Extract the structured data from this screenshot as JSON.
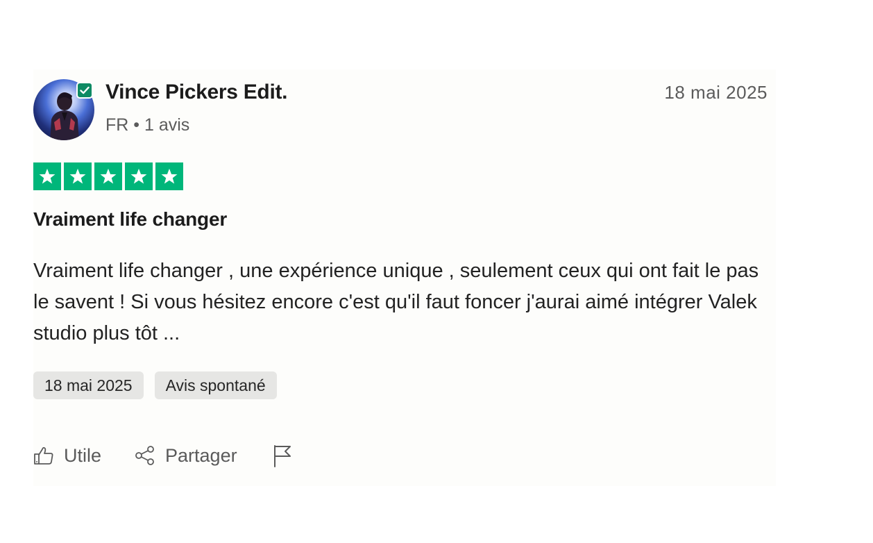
{
  "reviewer": {
    "name": "Vince Pickers Edit.",
    "country": "FR",
    "separator": "•",
    "review_count": "1 avis"
  },
  "review": {
    "date": "18 mai 2025",
    "rating": 5,
    "rating_max": 5,
    "title": "Vraiment life changer",
    "body": "Vraiment life changer , une expérience unique , seulement ceux qui ont fait le pas le savent ! Si vous hésitez encore c'est qu'il faut foncer j'aurai aimé intégrer Valek studio plus tôt ..."
  },
  "tags": [
    {
      "label": "18 mai 2025"
    },
    {
      "label": "Avis spontané"
    }
  ],
  "actions": {
    "like_label": "Utile",
    "share_label": "Partager"
  },
  "icons": {
    "verified": "verified-check-icon",
    "star": "star-icon",
    "like": "thumbs-up-icon",
    "share": "share-icon",
    "flag": "flag-icon"
  },
  "colors": {
    "star_green": "#00b67a",
    "verified_green": "#0e8a63",
    "tag_bg": "#e6e6e4",
    "muted_text": "#5b5b5b"
  }
}
